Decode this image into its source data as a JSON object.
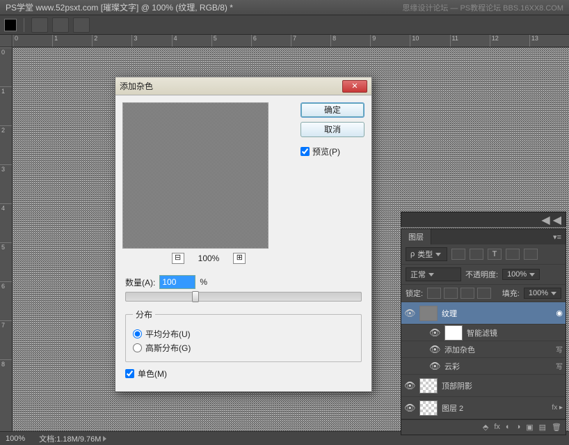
{
  "title": "PS学堂 www.52psxt.com [璀璨文字] @ 100% (纹理, RGB/8) *",
  "title_right": "思缘设计论坛 — PS教程论坛 BBS.16XX8.COM",
  "ruler_h": [
    "0",
    "1",
    "2",
    "3",
    "4",
    "5",
    "6",
    "7",
    "8",
    "9",
    "10",
    "11",
    "12",
    "13"
  ],
  "ruler_v": [
    "0",
    "1",
    "2",
    "3",
    "4",
    "5",
    "6",
    "7",
    "8"
  ],
  "status": {
    "zoom": "100%",
    "doc": "文档:1.18M/9.76M"
  },
  "dialog": {
    "title": "添加杂色",
    "ok": "确定",
    "cancel": "取消",
    "preview": "预览(P)",
    "zoom": "100%",
    "amount_label": "数量(A):",
    "amount_value": "100",
    "amount_pct": "%",
    "dist_legend": "分布",
    "dist_uniform": "平均分布(U)",
    "dist_gaussian": "高斯分布(G)",
    "mono": "单色(M)"
  },
  "layers_panel": {
    "tab": "图层",
    "kind": "类型",
    "blend": "正常",
    "opacity_label": "不透明度:",
    "opacity": "100%",
    "lock_label": "锁定:",
    "fill_label": "填充:",
    "fill": "100%",
    "layers": [
      {
        "name": "纹理",
        "selected": true,
        "smart": true
      },
      {
        "name": "智能滤镜",
        "sub": true,
        "white": true
      },
      {
        "name": "添加杂色",
        "sub": true,
        "filter": true,
        "tag": "写"
      },
      {
        "name": "云彩",
        "sub": true,
        "filter": true,
        "tag": "写"
      },
      {
        "name": "顶部阴影",
        "checker": true
      },
      {
        "name": "图层 2",
        "checker": true,
        "fx": "fx"
      }
    ]
  }
}
